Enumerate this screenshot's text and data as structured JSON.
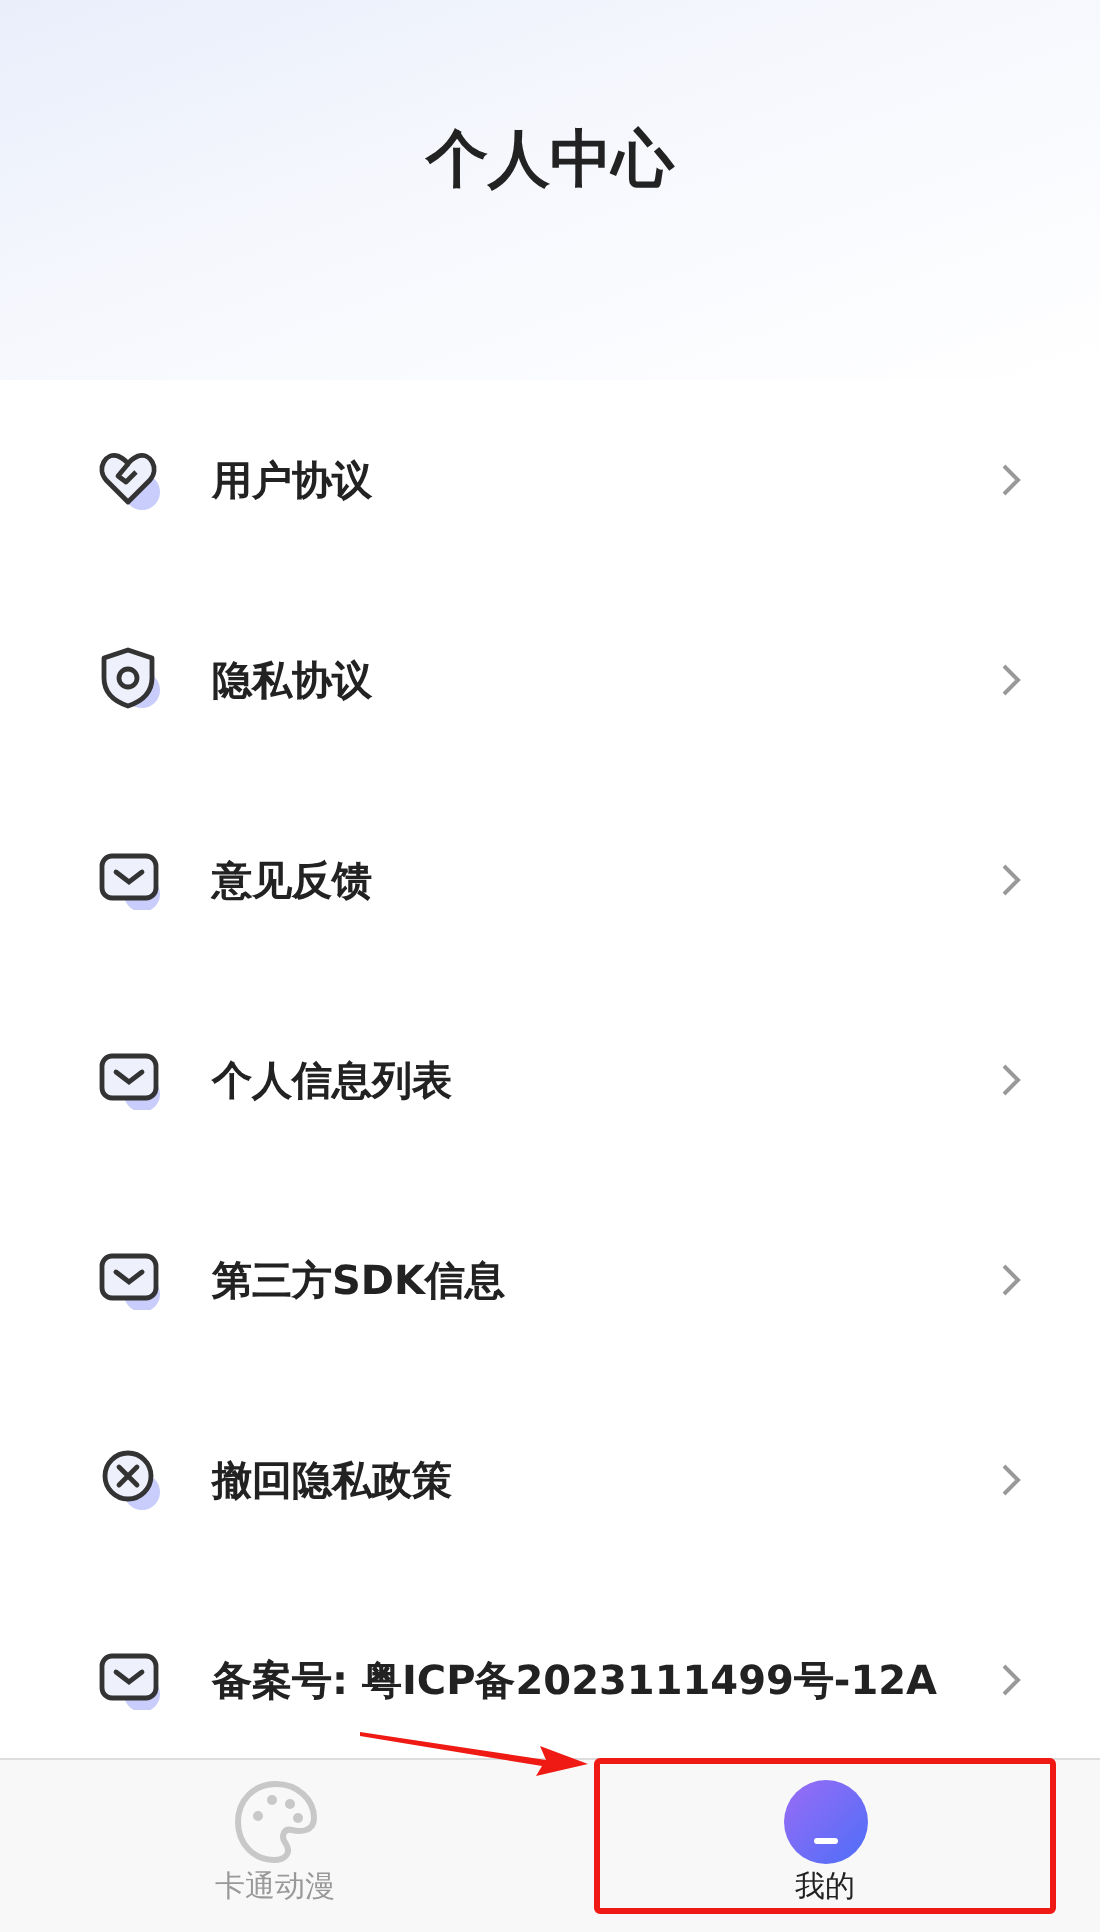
{
  "header": {
    "title": "个人中心"
  },
  "menu": [
    {
      "label": "用户协议",
      "kind": "heart"
    },
    {
      "label": "隐私协议",
      "kind": "shield"
    },
    {
      "label": "意见反馈",
      "kind": "mail"
    },
    {
      "label": "个人信息列表",
      "kind": "mail"
    },
    {
      "label": "第三方SDK信息",
      "kind": "mail"
    },
    {
      "label": "撤回隐私政策",
      "kind": "cancel"
    },
    {
      "label": "备案号: 粤ICP备2023111499号-12A",
      "kind": "mail"
    }
  ],
  "tab_bar": [
    {
      "label": "卡通动漫",
      "kind": "palette",
      "selected": false
    },
    {
      "label": "我的",
      "kind": "avatar",
      "selected": true
    }
  ]
}
